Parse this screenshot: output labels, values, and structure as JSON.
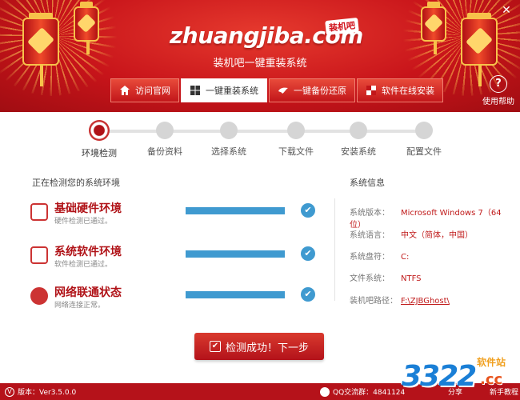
{
  "window": {
    "close_symbol": "✕"
  },
  "brand": {
    "logo_text": "zhuangjiba.com",
    "logo_badge": "装机吧",
    "subtitle": "装机吧一键重装系统"
  },
  "nav": {
    "items": [
      {
        "label": "访问官网",
        "icon": "home-icon"
      },
      {
        "label": "一键重装系统",
        "icon": "windows-icon"
      },
      {
        "label": "一键备份还原",
        "icon": "bird-icon"
      },
      {
        "label": "软件在线安装",
        "icon": "puzzle-icon"
      }
    ],
    "active_index": 1
  },
  "help": {
    "label": "使用帮助",
    "symbol": "?"
  },
  "steps": [
    {
      "label": "环境检测"
    },
    {
      "label": "备份资料"
    },
    {
      "label": "选择系统"
    },
    {
      "label": "下载文件"
    },
    {
      "label": "安装系统"
    },
    {
      "label": "配置文件"
    }
  ],
  "current_step": 0,
  "checks": {
    "title": "正在检测您的系统环境",
    "items": [
      {
        "title": "基础硬件环境",
        "subtitle": "硬件检测已通过。",
        "progress": 1.0,
        "icon": "hardware-icon"
      },
      {
        "title": "系统软件环境",
        "subtitle": "软件检测已通过。",
        "progress": 1.0,
        "icon": "monitor-icon"
      },
      {
        "title": "网络联通状态",
        "subtitle": "网络连接正常。",
        "progress": 1.0,
        "icon": "globe-icon"
      }
    ],
    "check_symbol": "✔"
  },
  "sysinfo": {
    "title": "系统信息",
    "rows": [
      {
        "key": "系统版本：",
        "value": "Microsoft Windows 7（64位）"
      },
      {
        "key": "系统语言：",
        "value": "中文（简体，中国）"
      },
      {
        "key": "系统盘符：",
        "value": "C:"
      },
      {
        "key": "文件系统：",
        "value": "NTFS"
      },
      {
        "key": "装机吧路径：",
        "value": "F:\\ZJBGhost\\"
      }
    ]
  },
  "next_button": {
    "label": "检测成功！下一步",
    "symbol": "✔"
  },
  "footer": {
    "version_symbol": "V",
    "version": "版本：Ver3.5.0.0",
    "qq": "QQ交流群：4841124",
    "share": "分享",
    "tutorial": "新手教程"
  },
  "watermark": {
    "number": "3322",
    "tld": ".cc",
    "site_label": "软件站"
  },
  "colors": {
    "brand_red": "#c8141a",
    "progress_blue": "#3f9ad0",
    "value_red": "#c01a1a"
  }
}
